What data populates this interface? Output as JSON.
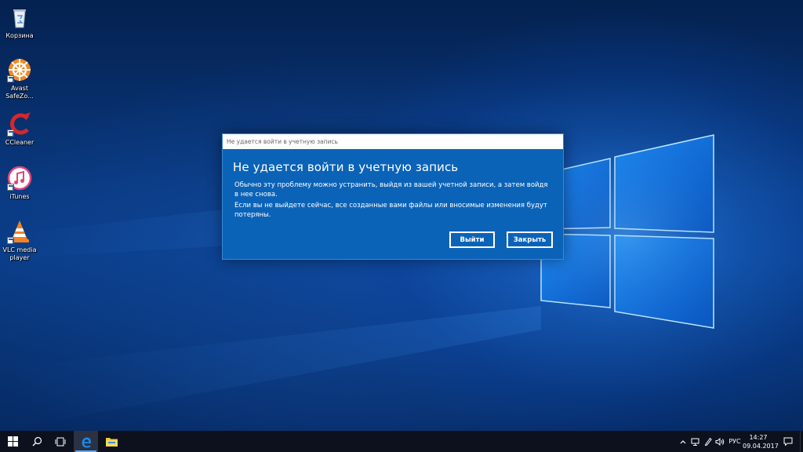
{
  "desktop": {
    "icons": [
      {
        "label": "Корзина"
      },
      {
        "label": "Avast SafeZo..."
      },
      {
        "label": "CCleaner"
      },
      {
        "label": "iTunes"
      },
      {
        "label": "VLC media player"
      }
    ]
  },
  "dialog": {
    "title_bar": "Не удается войти в учетную запись",
    "heading": "Не удается войти в учетную запись",
    "text_1": "Обычно эту проблему можно устранить, выйдя из вашей учетной записи, а затем войдя в нее снова.",
    "text_2": "Если вы не выйдете сейчас, все созданные вами файлы или вносимые изменения будут потеряны.",
    "signout_label": "Выйти",
    "close_label": "Закрыть"
  },
  "taskbar": {
    "icons": [
      "windows-icon",
      "search-icon",
      "task-view-icon",
      "edge-icon",
      "file-explorer-icon"
    ],
    "tray": {
      "language": "РУС",
      "time": "14:27",
      "date": "09.04.2017"
    }
  },
  "colors": {
    "dialog_bg": "#0b63b7",
    "taskbar_bg": "#0c111d",
    "edge_blue": "#1e88e5"
  }
}
